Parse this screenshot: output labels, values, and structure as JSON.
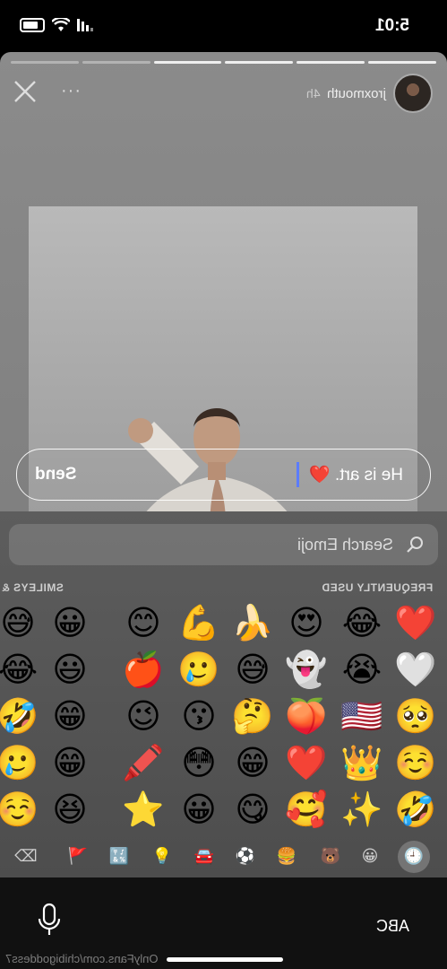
{
  "status": {
    "time": "5:01"
  },
  "story": {
    "username": "jroxmouth",
    "time_ago": "4h",
    "more": "···",
    "progress_total": 6,
    "progress_seen": 4
  },
  "reply": {
    "text": "He is art. ❤️",
    "send_label": "Send"
  },
  "keyboard": {
    "search_placeholder": "Search Emoji",
    "section_frequent": "FREQUENTLY USED",
    "section_smileys": "SMILEYS & F",
    "emojis": [
      [
        "❤️",
        "😂",
        "😍",
        "🍌",
        "💪",
        "😊",
        "",
        "😀",
        "😅"
      ],
      [
        "🤍",
        "😭",
        "👻",
        "😅",
        "🥲",
        "🍎",
        "",
        "😃",
        "😂"
      ],
      [
        "🥺",
        "🇺🇸",
        "🍑",
        "🤔",
        "😗",
        "😉",
        "",
        "😁",
        "🤣"
      ],
      [
        "☺️",
        "👑",
        "❤️",
        "😁",
        "😳",
        "🖍️",
        "",
        "😁",
        "🥲"
      ],
      [
        "🤣",
        "✨",
        "🥰",
        "😋",
        "😀",
        "⭐",
        "",
        "😆",
        "☺️"
      ]
    ],
    "categories": [
      "🕘",
      "😀",
      "🐻",
      "🍔",
      "⚽",
      "🚘",
      "💡",
      "🔣",
      "🚩",
      "⌫"
    ],
    "abc_label": "ABC"
  },
  "watermark": "OnlyFans.com/chibigoddess7"
}
